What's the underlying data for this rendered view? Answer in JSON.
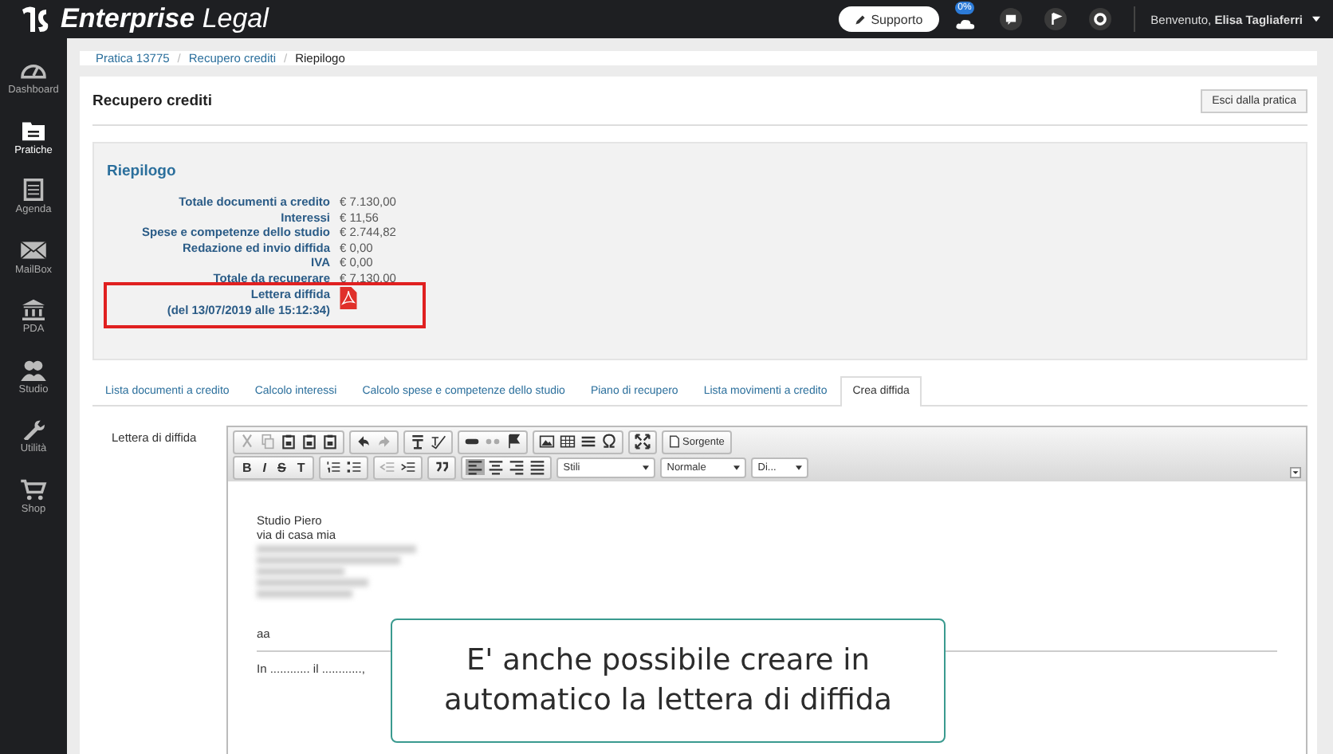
{
  "topbar": {
    "brand": "**Enterprise** Legal",
    "support_button": "Supporto",
    "sync_badge": "0%",
    "greeting": "Benvenuto, **Elisa Tagliaferri**"
  },
  "sidebar": {
    "items": [
      {
        "label": "Dashboard",
        "kind": "gauge",
        "selected": false
      },
      {
        "label": "Pratiche",
        "kind": "folder",
        "selected": true
      },
      {
        "label": "Agenda",
        "kind": "calendar",
        "selected": false
      },
      {
        "label": "MailBox",
        "kind": "mail",
        "selected": false
      },
      {
        "label": "PDA",
        "kind": "bank",
        "selected": false
      },
      {
        "label": "Studio",
        "kind": "people",
        "selected": false
      },
      {
        "label": "Utilità",
        "kind": "wrench",
        "selected": false
      },
      {
        "label": "Shop",
        "kind": "cart",
        "selected": false
      }
    ]
  },
  "breadcrumb_separator": "/",
  "breadcrumb": [
    {
      "label": "Pratica 13775",
      "kind": "link"
    },
    {
      "label": "Recupero crediti",
      "kind": "link"
    },
    {
      "label": "Riepilogo",
      "kind": "current"
    }
  ],
  "card": {
    "title": "Recupero crediti",
    "exit_button": "Esci dalla pratica"
  },
  "summary": {
    "title": "Riepilogo",
    "rows": [
      {
        "label": "Totale documenti a credito",
        "value": "€ 7.130,00"
      },
      {
        "label": "Interessi",
        "value": "€ 11,56"
      },
      {
        "label": "Spese e competenze dello studio",
        "value": "€ 2.744,82"
      },
      {
        "label": "Redazione ed invio diffida",
        "value": "€ 0,00"
      },
      {
        "label": "IVA",
        "value": "€ 0,00"
      },
      {
        "label": "Totale da recuperare",
        "value": "€ 7.130,00"
      }
    ],
    "letter": {
      "label": "Lettera diffida",
      "date": "(del 13/07/2019 alle 15:12:34)",
      "highlighted": true
    }
  },
  "tabs": [
    {
      "label": "Lista documenti a credito",
      "selected": false
    },
    {
      "label": "Calcolo interessi",
      "selected": false
    },
    {
      "label": "Calcolo spese e competenze dello studio",
      "selected": false
    },
    {
      "label": "Piano di recupero",
      "selected": false
    },
    {
      "label": "Lista movimenti a credito",
      "selected": false
    },
    {
      "label": "Crea diffida",
      "selected": true
    }
  ],
  "editor": {
    "label": "Lettera di diffida",
    "toolbar_1": [
      [
        {
          "kind": "cut",
          "disabled": true
        },
        {
          "kind": "copy",
          "disabled": true
        },
        {
          "kind": "paste",
          "disabled": false
        },
        {
          "kind": "paste",
          "disabled": false
        },
        {
          "kind": "paste",
          "disabled": false
        }
      ],
      [
        {
          "kind": "undo",
          "disabled": false
        },
        {
          "kind": "redo",
          "disabled": true
        }
      ],
      [
        {
          "kind": "block",
          "disabled": false
        },
        {
          "kind": "spell",
          "disabled": false
        }
      ],
      [
        {
          "kind": "link",
          "disabled": false
        },
        {
          "kind": "unlink",
          "disabled": true
        },
        {
          "kind": "flag",
          "disabled": false
        }
      ],
      [
        {
          "kind": "image",
          "disabled": false
        },
        {
          "kind": "table",
          "disabled": false
        },
        {
          "kind": "rule",
          "disabled": false
        },
        {
          "kind": "omega",
          "disabled": false
        }
      ],
      [
        {
          "kind": "maximize",
          "disabled": false
        }
      ],
      [
        {
          "kind": "source",
          "label": "Sorgente",
          "disabled": false
        }
      ]
    ],
    "format_buttons": [
      "B",
      "I",
      "S",
      "T"
    ],
    "toolbar_2": [
      [
        {
          "kind": "olist",
          "selected": false
        },
        {
          "kind": "ulist",
          "selected": false
        }
      ],
      [
        {
          "kind": "outdent",
          "selected": false
        },
        {
          "kind": "indent",
          "selected": false
        }
      ],
      [
        {
          "kind": "quote",
          "selected": false
        }
      ],
      [
        {
          "kind": "align-left",
          "selected": true
        },
        {
          "kind": "align-center",
          "selected": false
        },
        {
          "kind": "align-right",
          "selected": false
        },
        {
          "kind": "justify",
          "selected": false
        }
      ]
    ],
    "dropdowns": [
      "Stili",
      "Normale",
      "Di..."
    ],
    "lines": [
      {
        "kind": "text",
        "text": "Studio Piero"
      },
      {
        "kind": "text",
        "text": "via di casa mia"
      },
      {
        "kind": "blurred"
      },
      {
        "kind": "blurred"
      },
      {
        "kind": "blurred"
      },
      {
        "kind": "blurred"
      },
      {
        "kind": "blurred"
      },
      {
        "kind": "blank"
      },
      {
        "kind": "text",
        "text": "aa"
      },
      {
        "kind": "rule"
      },
      {
        "kind": "text",
        "text": "In ............ il ............,"
      }
    ]
  },
  "caption": "E' anche possibile creare in automatico la lettera di diffida"
}
